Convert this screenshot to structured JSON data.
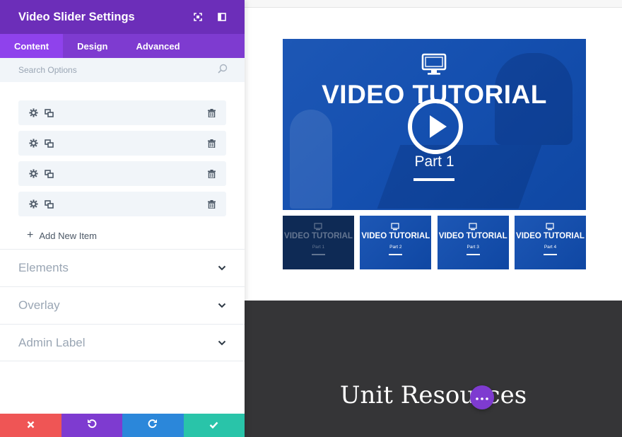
{
  "panel": {
    "title": "Video Slider Settings",
    "header_icons": [
      "fullscreen-icon",
      "sidebar-layout-icon"
    ],
    "tabs": [
      {
        "label": "Content",
        "active": true
      },
      {
        "label": "Design",
        "active": false
      },
      {
        "label": "Advanced",
        "active": false
      }
    ],
    "search": {
      "placeholder": "Search Options"
    },
    "items": [
      {
        "icons": [
          "gear-icon",
          "duplicate-icon",
          "trash-icon"
        ]
      },
      {
        "icons": [
          "gear-icon",
          "duplicate-icon",
          "trash-icon"
        ]
      },
      {
        "icons": [
          "gear-icon",
          "duplicate-icon",
          "trash-icon"
        ]
      },
      {
        "icons": [
          "gear-icon",
          "duplicate-icon",
          "trash-icon"
        ]
      }
    ],
    "add_item_label": "Add New Item",
    "toggles": [
      {
        "label": "Elements"
      },
      {
        "label": "Overlay"
      },
      {
        "label": "Admin Label"
      }
    ],
    "footer": {
      "buttons": [
        {
          "name": "discard",
          "icon": "close-icon",
          "color": "#ef5555"
        },
        {
          "name": "undo",
          "icon": "undo-icon",
          "color": "#7e3bd0"
        },
        {
          "name": "redo",
          "icon": "redo-icon",
          "color": "#2b87da"
        },
        {
          "name": "save",
          "icon": "check-icon",
          "color": "#29c4a9"
        }
      ]
    },
    "colors": {
      "header": "#6c2eb9",
      "tabs": "#7e3bd0",
      "active_tab": "#8f42ec"
    }
  },
  "preview": {
    "main_video": {
      "title": "VIDEO TUTORIAL",
      "part": "Part 1",
      "color": "#1550b0"
    },
    "thumbnails": [
      {
        "title": "VIDEO TUTORIAL",
        "part": "Part 1",
        "dimmed": true
      },
      {
        "title": "VIDEO TUTORIAL",
        "part": "Part 2",
        "dimmed": false
      },
      {
        "title": "VIDEO TUTORIAL",
        "part": "Part 3",
        "dimmed": false
      },
      {
        "title": "VIDEO TUTORIAL",
        "part": "Part 4",
        "dimmed": false
      }
    ],
    "section_heading": "Unit Resources",
    "section_bg": "#353537",
    "more_button_icon": "more-dots-icon"
  }
}
